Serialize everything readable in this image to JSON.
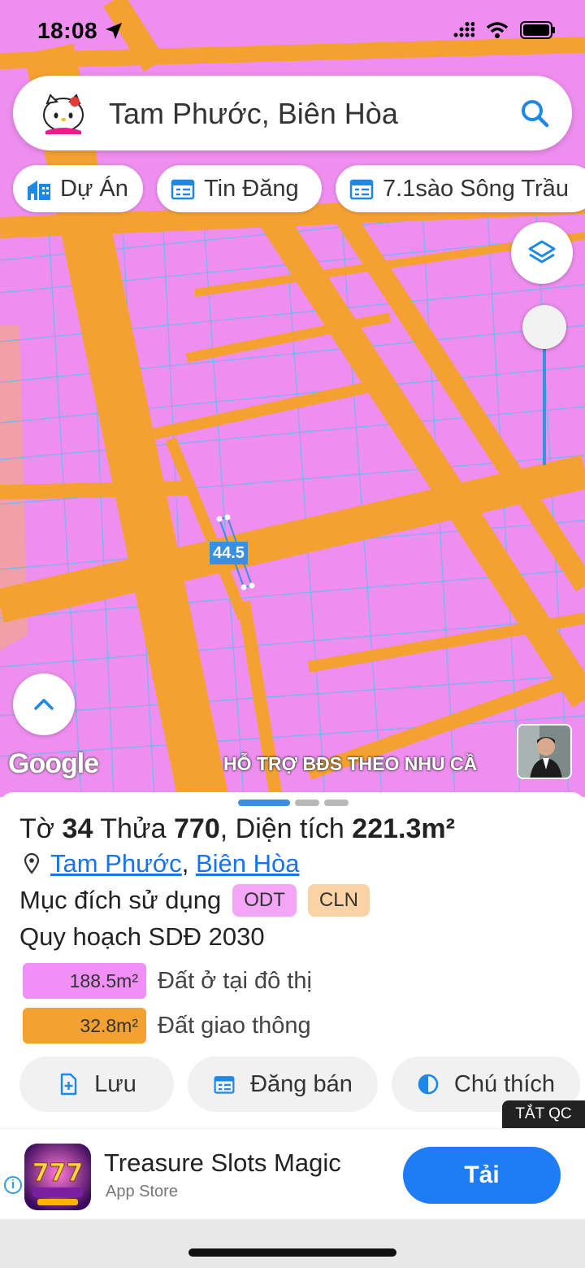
{
  "status_bar": {
    "time": "18:08"
  },
  "search": {
    "text": "Tam Phước, Biên Hòa"
  },
  "chips": [
    {
      "label": "Dự Án",
      "icon": "building-icon"
    },
    {
      "label": "Tin Đăng",
      "icon": "listing-icon"
    },
    {
      "label": "7.1sào Sông Trầu",
      "icon": "listing-icon"
    }
  ],
  "map": {
    "measure_label": "44.5",
    "google_label": "Google",
    "watermark": "HỖ TRỢ BĐS  THEO NHU CẦ",
    "colors": {
      "residential": "#ee8eef",
      "road": "#f5a132",
      "parcel_line": "#6fb7f0",
      "other_land": "#f2a0a8"
    }
  },
  "sheet": {
    "title_prefix": "Tờ",
    "sheet_no": "34",
    "parcel_word": "Thửa",
    "parcel_no": "770",
    "area_word": ", Diện tích",
    "area_value": "221.3m²",
    "location": {
      "ward": "Tam Phước",
      "separator": ",",
      "city": "Biên Hòa"
    },
    "purpose_label": "Mục đích sử dụng",
    "tags": [
      "ODT",
      "CLN"
    ],
    "plan_label": "Quy hoạch SDĐ 2030",
    "areas": [
      {
        "value": "188.5m²",
        "desc": "Đất ở tại đô thị",
        "color": "#f08ff5"
      },
      {
        "value": "32.8m²",
        "desc": "Đất giao thông",
        "color": "#f5a132"
      }
    ],
    "actions": {
      "save": "Lưu",
      "post": "Đăng bán",
      "legend": "Chú thích"
    }
  },
  "ad": {
    "close_label": "TẮT QC",
    "title": "Treasure Slots Magic",
    "subtitle": "App Store",
    "cta": "Tải",
    "info": "i",
    "app_icon_text": "777"
  }
}
